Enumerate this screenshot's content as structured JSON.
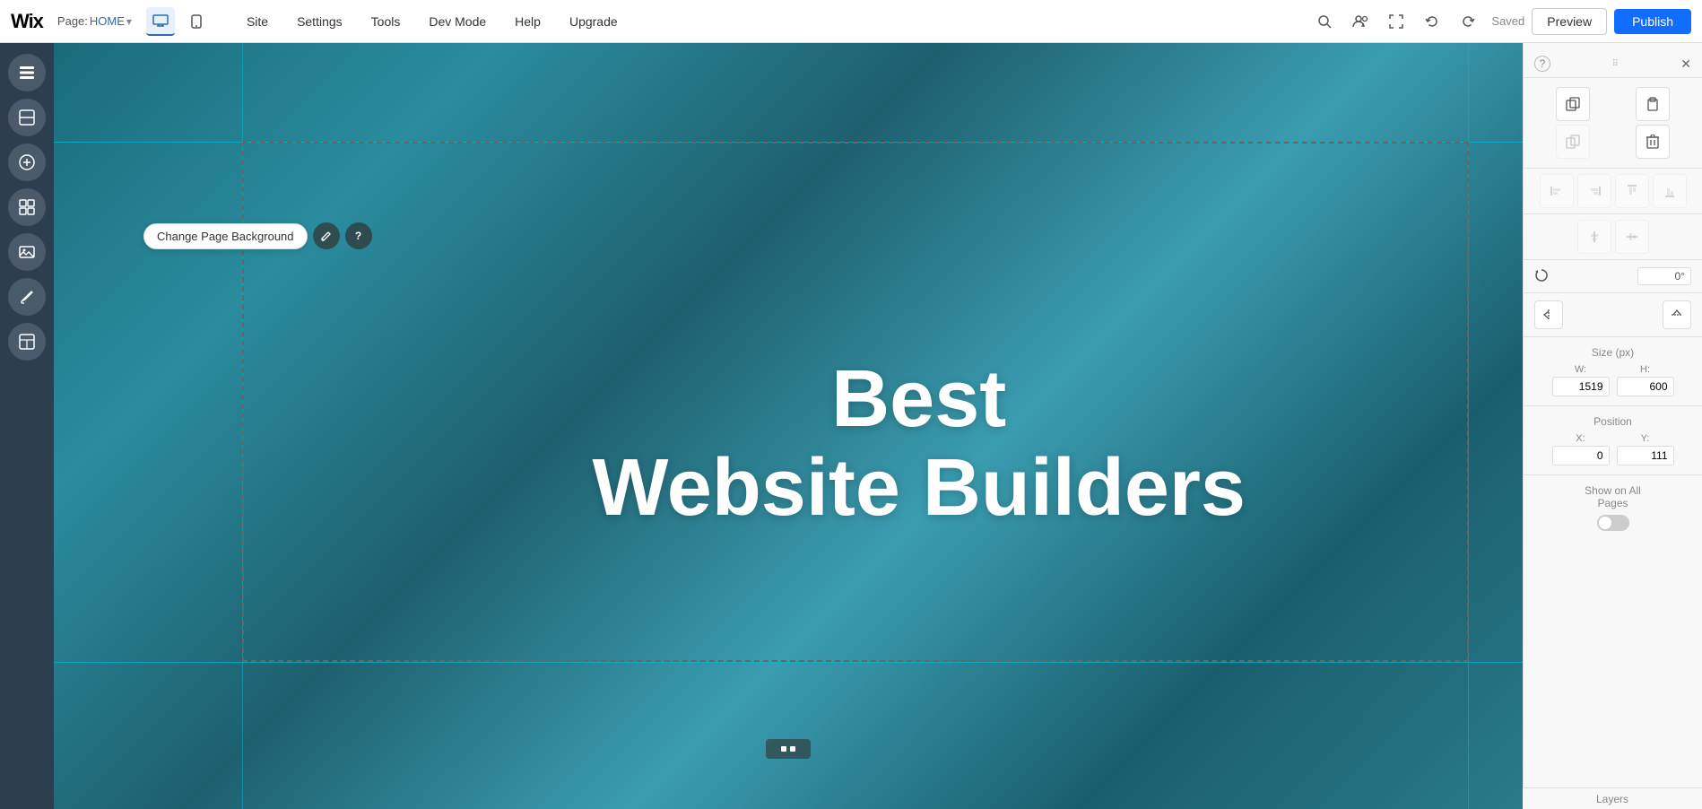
{
  "topbar": {
    "logo": "Wix",
    "page_label": "Page:",
    "page_name": "HOME",
    "chevron": "▾",
    "nav_items": [
      "Site",
      "Settings",
      "Tools",
      "Dev Mode",
      "Help",
      "Upgrade"
    ],
    "saved_label": "Saved",
    "preview_label": "Preview",
    "publish_label": "Publish"
  },
  "left_sidebar": {
    "buttons": [
      {
        "name": "pages-icon",
        "icon": "☰"
      },
      {
        "name": "sections-icon",
        "icon": "▣"
      },
      {
        "name": "add-icon",
        "icon": "+"
      },
      {
        "name": "add-section-icon",
        "icon": "⊞"
      },
      {
        "name": "media-icon",
        "icon": "⌗"
      },
      {
        "name": "blog-icon",
        "icon": "✒"
      },
      {
        "name": "app-icon",
        "icon": "⊟"
      }
    ]
  },
  "canvas": {
    "toolbar": {
      "change_bg_label": "Change Page Background",
      "edit_icon": "✏",
      "help_icon": "?"
    },
    "headline_line1": "Best",
    "headline_line2": "Website Builders"
  },
  "right_panel": {
    "help_label": "?",
    "close_label": "✕",
    "size_title": "Size (px)",
    "width_label": "W:",
    "width_value": "1519",
    "height_label": "H:",
    "height_value": "600",
    "position_title": "Position",
    "x_label": "X:",
    "x_value": "0",
    "y_label": "Y:",
    "y_value": "111",
    "show_on_pages_label": "Show on All Pages",
    "layers_label": "Layers",
    "rotation_value": "0°"
  }
}
